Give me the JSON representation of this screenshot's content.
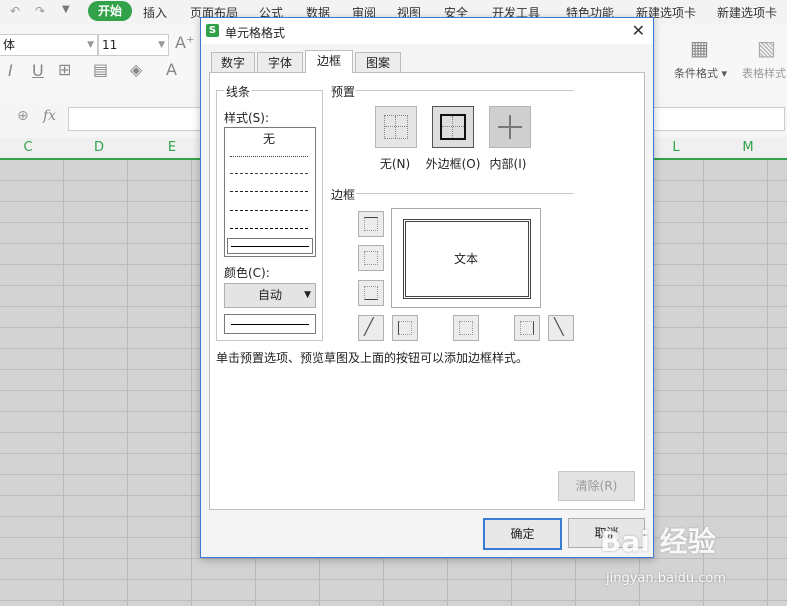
{
  "menu": {
    "start": "开始",
    "items": [
      "插入",
      "页面布局",
      "公式",
      "数据",
      "审阅",
      "视图",
      "安全",
      "开发工具",
      "特色功能",
      "新建选项卡",
      "新建选项卡"
    ]
  },
  "ribbon": {
    "font_name": "体",
    "font_size": "11",
    "conditional_format": "条件格式",
    "table_style": "表格样式"
  },
  "formula_bar": {
    "fx": "fx"
  },
  "columns": [
    "C",
    "D",
    "E",
    "L",
    "M"
  ],
  "dialog": {
    "title": "单元格格式",
    "tabs": [
      "数字",
      "字体",
      "边框",
      "图案"
    ],
    "active_tab": "边框",
    "line_group": "线条",
    "style_label": "样式(S):",
    "style_none": "无",
    "color_label": "颜色(C):",
    "color_value": "自动",
    "preset_group": "预置",
    "presets": [
      "无(N)",
      "外边框(O)",
      "内部(I)"
    ],
    "border_group": "边框",
    "preview_text": "文本",
    "hint": "单击预置选项、预览草图及上面的按钮可以添加边框样式。",
    "clear_button": "清除(R)",
    "ok_button": "确定",
    "cancel_button": "取消"
  },
  "watermark": {
    "logo": "Bai 经验",
    "url": "jingyan.baidu.com"
  }
}
